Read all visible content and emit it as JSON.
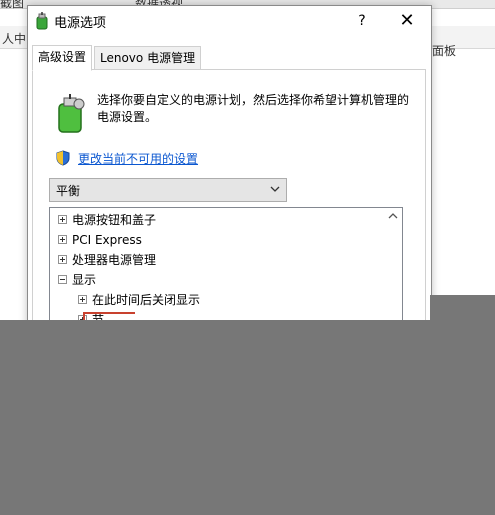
{
  "background_app": {
    "tab_fragment": "截图",
    "tab_fragment_2": "数据透视",
    "left_fragment": "人中",
    "right_fragment": "面板"
  },
  "dialog": {
    "title": "电源选项",
    "help_label": "?",
    "close_label": "✕",
    "tabs": [
      {
        "label": "高级设置",
        "active": true
      },
      {
        "label": "Lenovo 电源管理",
        "active": false
      }
    ],
    "description": "选择你要自定义的电源计划，然后选择你希望计算机管理的电源设置。",
    "change_settings_link": "更改当前不可用的设置",
    "plan_select": {
      "value": "平衡"
    },
    "tree": {
      "items": [
        {
          "label": "电源按钮和盖子",
          "state": "collapsed"
        },
        {
          "label": "PCI Express",
          "state": "collapsed"
        },
        {
          "label": "处理器电源管理",
          "state": "collapsed"
        },
        {
          "label": "显示",
          "state": "expanded"
        },
        {
          "label": "在此时间后关闭显示",
          "state": "collapsed"
        },
        {
          "label": "节",
          "state": "collapsed"
        }
      ]
    }
  },
  "colors": {
    "link": "#0b57d0",
    "overlay": "#777777",
    "highlight_box": "#c8412e"
  }
}
